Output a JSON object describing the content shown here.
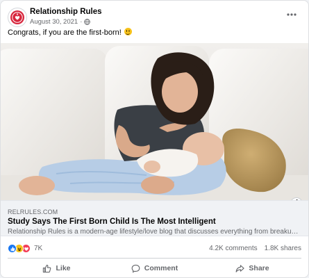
{
  "post": {
    "page_name": "Relationship Rules",
    "date": "August 30, 2021",
    "separator": "·",
    "caption": "Congrats, if you are the first-born!",
    "caption_emoji": "grinning-face-emoji"
  },
  "link_preview": {
    "domain": "RELRULES.COM",
    "title": "Study Says The First Born Child Is The Most Intelligent",
    "description": "Relationship Rules is a modern-age lifestyle/love blog that discusses everything from breakups..."
  },
  "stats": {
    "reaction_types": [
      "like",
      "haha",
      "love"
    ],
    "reactions_count": "7K",
    "comments": "4.2K comments",
    "shares": "1.8K shares"
  },
  "actions": {
    "like": "Like",
    "comment": "Comment",
    "share": "Share"
  },
  "icons": {
    "avatar": "relationship-rules-logo",
    "audience": "globe-icon",
    "more": "more-options-icon",
    "info": "info-icon"
  },
  "colors": {
    "like_blue": "#1877f2",
    "love_red": "#f33e58",
    "haha_yellow": "#f7c21a",
    "logo_red": "#d7263d",
    "secondary_text": "#65676b"
  }
}
